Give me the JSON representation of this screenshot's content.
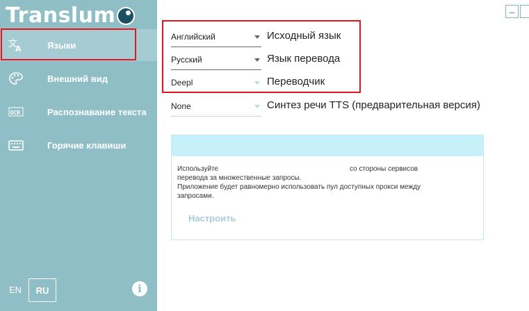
{
  "app": {
    "title": "Translum"
  },
  "sidebar": {
    "items": [
      {
        "label": "Языки",
        "icon": "translate-icon",
        "active": true
      },
      {
        "label": "Внешний вид",
        "icon": "palette-icon",
        "active": false
      },
      {
        "label": "Распознавание текста",
        "icon": "ocr-icon",
        "active": false
      },
      {
        "label": "Горячие клавиши",
        "icon": "keyboard-icon",
        "active": false
      }
    ],
    "lang_en": "EN",
    "lang_ru": "RU",
    "info": "i"
  },
  "window": {
    "minimize_symbol": "–"
  },
  "form": {
    "source": {
      "value": "Английский",
      "label": "Исходный язык"
    },
    "target": {
      "value": "Русский",
      "label": "Язык перевода"
    },
    "translator": {
      "value": "Deepl",
      "label": "Переводчик"
    },
    "tts": {
      "value": "None",
      "label": "Синтез речи TTS (предварительная версия)"
    }
  },
  "proxy": {
    "line1": "Используйте                                                                    со стороны сервисов",
    "line2": "перевода за множественные запросы.",
    "line3": "Приложение будет равномерно использовать пул доступных прокси между",
    "line4": "запросами.",
    "configure_label": "Настроить"
  },
  "colors": {
    "sidebar": "#8fbec6",
    "active_item": "#a6ccd3",
    "highlight": "#e8141c",
    "proxy_header": "#c6f0fa"
  }
}
